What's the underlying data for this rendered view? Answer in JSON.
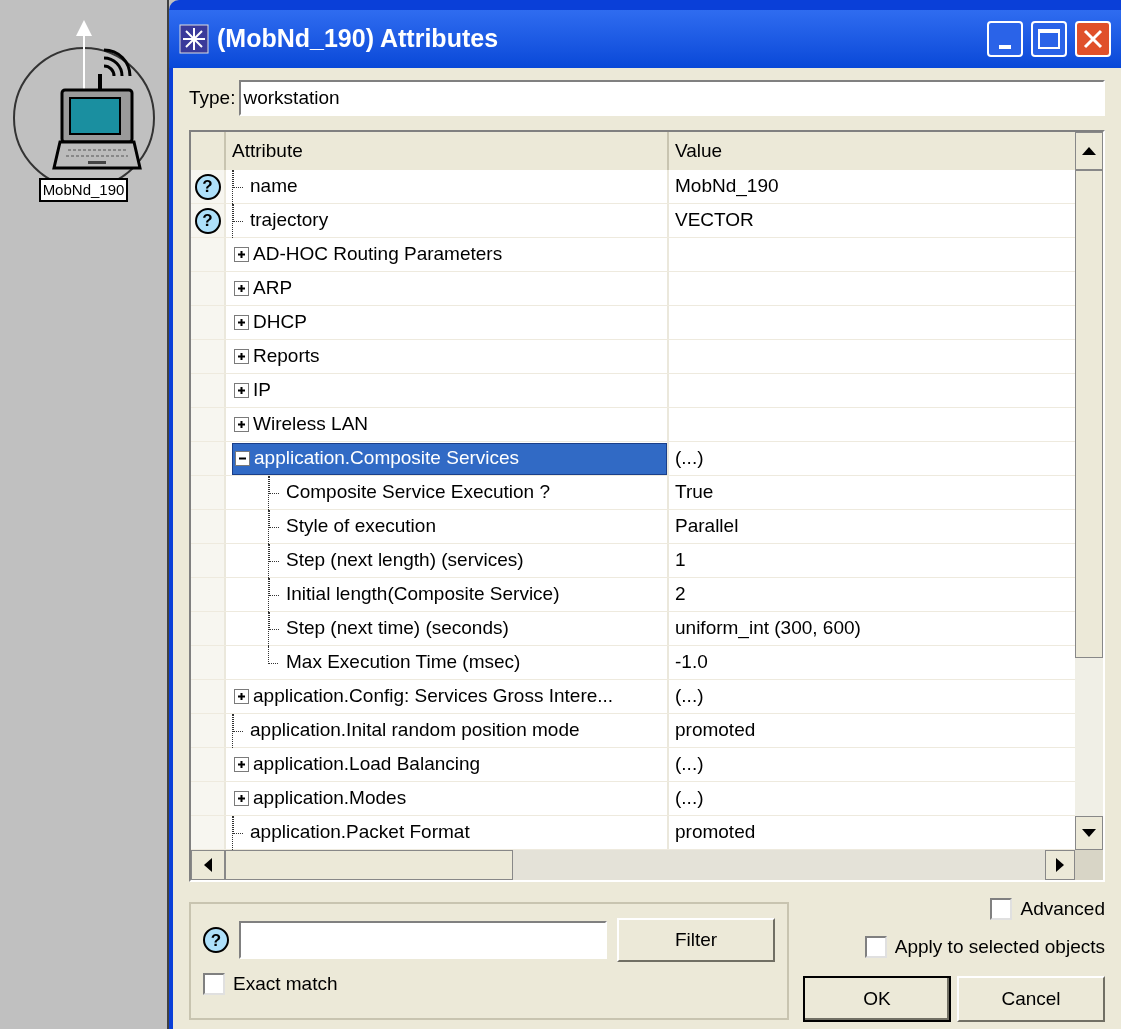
{
  "node": {
    "label": "MobNd_190"
  },
  "window": {
    "title": "(MobNd_190) Attributes"
  },
  "type_field": {
    "label": "Type:",
    "value": "workstation"
  },
  "table": {
    "columns": [
      "Attribute",
      "Value"
    ],
    "rows": [
      {
        "kind": "leaf",
        "help_icon": "?",
        "label": "name",
        "value": "MobNd_190",
        "selected": false
      },
      {
        "kind": "leaf",
        "help_icon": "?",
        "label": "trajectory",
        "value": "VECTOR",
        "selected": false
      },
      {
        "kind": "group",
        "expanded": false,
        "label": "AD-HOC Routing Parameters",
        "selected": false
      },
      {
        "kind": "group",
        "expanded": false,
        "label": "ARP",
        "selected": false
      },
      {
        "kind": "group",
        "expanded": false,
        "label": "DHCP",
        "selected": false
      },
      {
        "kind": "group",
        "expanded": false,
        "label": "Reports",
        "selected": false
      },
      {
        "kind": "group",
        "expanded": false,
        "label": "IP",
        "selected": false
      },
      {
        "kind": "group",
        "expanded": false,
        "label": "Wireless LAN",
        "selected": false
      },
      {
        "kind": "group",
        "expanded": true,
        "label": "application.Composite Services",
        "value": "(...)",
        "selected": true,
        "children": [
          {
            "kind": "leaf",
            "label": "Composite Service Execution ?",
            "value": "True",
            "selected": false
          },
          {
            "kind": "leaf",
            "label": "Style of execution",
            "value": "Parallel",
            "selected": false
          },
          {
            "kind": "leaf",
            "label": "Step (next length) (services)",
            "value": "1",
            "selected": false
          },
          {
            "kind": "leaf",
            "label": "Initial length(Composite Service)",
            "value": "2",
            "selected": false
          },
          {
            "kind": "leaf",
            "label": "Step (next time) (seconds)",
            "value": "uniform_int (300, 600)",
            "selected": false
          },
          {
            "kind": "leaf",
            "label": "Max Execution Time (msec)",
            "value": "-1.0",
            "selected": false
          }
        ]
      },
      {
        "kind": "group",
        "expanded": false,
        "label": "application.Config: Services Gross Intere...",
        "value": "(...)",
        "selected": false
      },
      {
        "kind": "leaf",
        "label": "application.Inital random position mode",
        "value": "promoted",
        "selected": false
      },
      {
        "kind": "group",
        "expanded": false,
        "label": "application.Load Balancing",
        "value": "(...)",
        "selected": false
      },
      {
        "kind": "group",
        "expanded": false,
        "label": "application.Modes",
        "value": "(...)",
        "selected": false
      },
      {
        "kind": "leaf",
        "label": "application.Packet Format",
        "value": "promoted",
        "selected": false
      }
    ]
  },
  "filter": {
    "help_icon": "?",
    "button": "Filter",
    "exact_match": {
      "label": "Exact match",
      "checked": false
    }
  },
  "advanced": {
    "label": "Advanced",
    "checked": false
  },
  "apply_selected": {
    "label": "Apply to selected objects",
    "checked": false
  },
  "buttons": [
    {
      "label": "OK",
      "default": true
    },
    {
      "label": "Cancel",
      "default": false
    }
  ]
}
